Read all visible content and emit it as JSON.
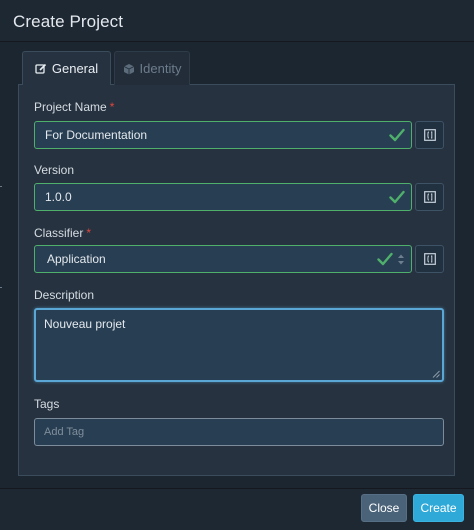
{
  "dialog": {
    "title": "Create Project",
    "tabs": [
      {
        "label": "General",
        "icon": "edit-icon",
        "active": true
      },
      {
        "label": "Identity",
        "icon": "cube-icon",
        "active": false
      }
    ]
  },
  "form": {
    "project_name": {
      "label": "Project Name",
      "required": "*",
      "value": "For Documentation",
      "valid": true
    },
    "version": {
      "label": "Version",
      "value": "1.0.0",
      "valid": true
    },
    "classifier": {
      "label": "Classifier",
      "required": "*",
      "value": "Application",
      "valid": true
    },
    "description": {
      "label": "Description",
      "value": "Nouveau projet"
    },
    "tags": {
      "label": "Tags",
      "placeholder": "Add Tag",
      "value": ""
    }
  },
  "footer": {
    "close_label": "Close",
    "create_label": "Create"
  },
  "colors": {
    "valid_green": "#4fb06c",
    "required_red": "#e0463f",
    "primary_button": "#2fa9d8",
    "secondary_button": "#4a6379",
    "focus_blue": "#5aa7d6"
  }
}
